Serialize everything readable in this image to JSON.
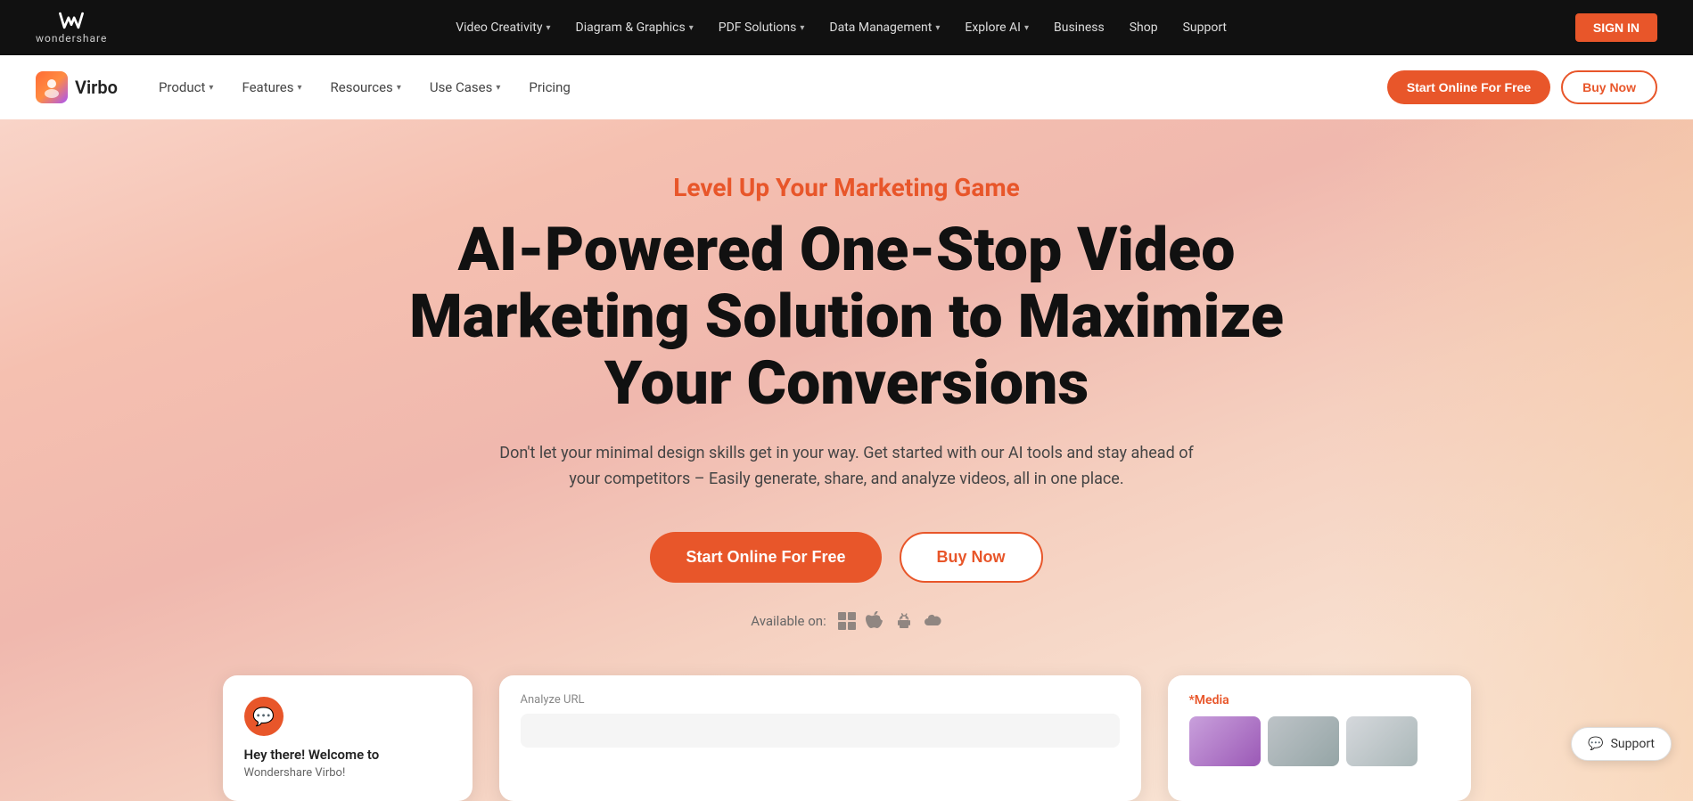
{
  "topNav": {
    "logo_text": "wondershare",
    "links": [
      {
        "label": "Video Creativity",
        "has_chevron": true
      },
      {
        "label": "Diagram & Graphics",
        "has_chevron": true
      },
      {
        "label": "PDF Solutions",
        "has_chevron": true
      },
      {
        "label": "Data Management",
        "has_chevron": true
      },
      {
        "label": "Explore AI",
        "has_chevron": true
      },
      {
        "label": "Business"
      },
      {
        "label": "Shop"
      },
      {
        "label": "Support"
      }
    ],
    "sign_in": "SIGN IN"
  },
  "subNav": {
    "brand": "Virbo",
    "links": [
      {
        "label": "Product",
        "has_chevron": true
      },
      {
        "label": "Features",
        "has_chevron": true
      },
      {
        "label": "Resources",
        "has_chevron": true
      },
      {
        "label": "Use Cases",
        "has_chevron": true
      },
      {
        "label": "Pricing"
      }
    ],
    "start_free": "Start Online For Free",
    "buy_now": "Buy Now"
  },
  "hero": {
    "tagline": "Level Up Your Marketing Game",
    "title": "AI-Powered One-Stop Video Marketing Solution to Maximize Your Conversions",
    "subtitle": "Don't let your minimal design skills get in your way. Get started with our AI tools and stay ahead of your competitors – Easily generate, share, and analyze videos, all in one place.",
    "start_btn": "Start Online For Free",
    "buy_btn": "Buy Now",
    "available_label": "Available on:"
  },
  "chatCard": {
    "title": "Hey there! Welcome to",
    "subtitle": "Wondershare Virbo!"
  },
  "urlCard": {
    "label": "Analyze URL"
  },
  "mediaCard": {
    "label": "*Media"
  },
  "support": {
    "label": "Support"
  }
}
